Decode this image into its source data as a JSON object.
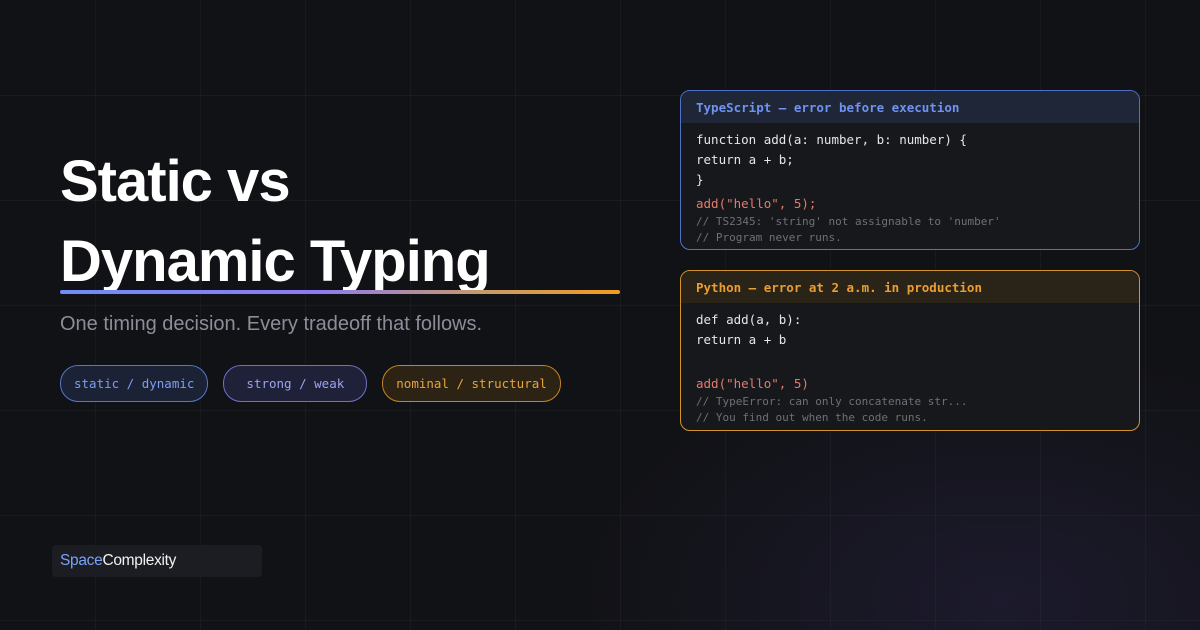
{
  "hero": {
    "title_line1": "Static vs",
    "title_line2": "Dynamic Typing",
    "subtitle": "One timing decision. Every tradeoff that follows."
  },
  "tags": [
    {
      "label": "static / dynamic"
    },
    {
      "label": "strong / weak"
    },
    {
      "label": "nominal / structural"
    }
  ],
  "ts_card": {
    "header": "TypeScript — error before execution",
    "code": [
      "function add(a: number, b: number) {",
      "return a + b;",
      "}"
    ],
    "call": "add(\"hello\", 5);",
    "comments": [
      "// TS2345: 'string' not assignable to 'number'",
      "// Program never runs."
    ]
  },
  "py_card": {
    "header": "Python — error at 2 a.m. in production",
    "code": [
      "def add(a, b):",
      "return a + b"
    ],
    "call": "add(\"hello\", 5)",
    "comments": [
      "// TypeError: can only concatenate str...",
      "// You find out when the code runs."
    ]
  },
  "brand": {
    "part1": "Space",
    "part2": "Complexity"
  },
  "colors": {
    "accent_blue": "#4f72c6",
    "accent_amber": "#d4922d",
    "error_red": "#e77a6b"
  }
}
